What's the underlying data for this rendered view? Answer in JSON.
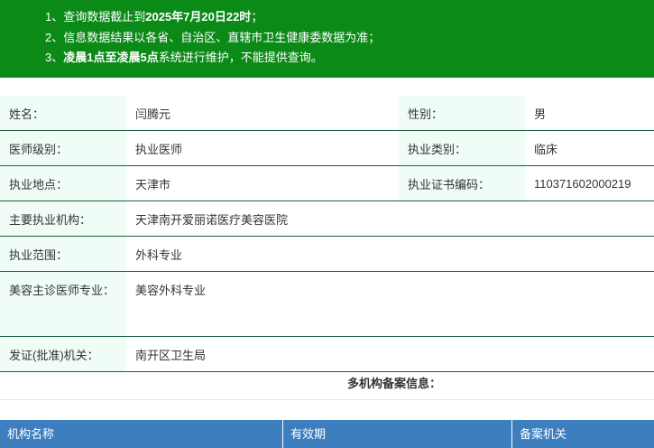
{
  "notice": {
    "line1_prefix": "1、查询数据截止到",
    "line1_bold": "2025年7月20日22时",
    "line1_suffix": "；",
    "line2": "2、信息数据结果以各省、自治区、直辖市卫生健康委数据为准；",
    "line3_prefix": "3、",
    "line3_bold": "凌晨1点至凌晨5点",
    "line3_suffix": "系统进行维护，不能提供查询。"
  },
  "fields": {
    "name_label": "姓名：",
    "name_value": "闫腾元",
    "gender_label": "性别：",
    "gender_value": "男",
    "level_label": "医师级别：",
    "level_value": "执业医师",
    "category_label": "执业类别：",
    "category_value": "临床",
    "location_label": "执业地点：",
    "location_value": "天津市",
    "cert_label": "执业证书编码：",
    "cert_value": "110371602000219",
    "institution_label": "主要执业机构：",
    "institution_value": "天津南开爱丽诺医疗美容医院",
    "scope_label": "执业范围：",
    "scope_value": "外科专业",
    "cosmetic_label": "美容主诊医师专业：",
    "cosmetic_value": "美容外科专业",
    "issuer_label": "发证(批准)机关：",
    "issuer_value": "南开区卫生局"
  },
  "multi_institution_title": "多机构备案信息：",
  "table_headers": [
    "机构名称",
    "有效期",
    "备案机关"
  ],
  "colors": {
    "notice_bg": "#0b8a17",
    "label_bg": "#f0fcf6",
    "header_bg": "#3d7ebf"
  }
}
